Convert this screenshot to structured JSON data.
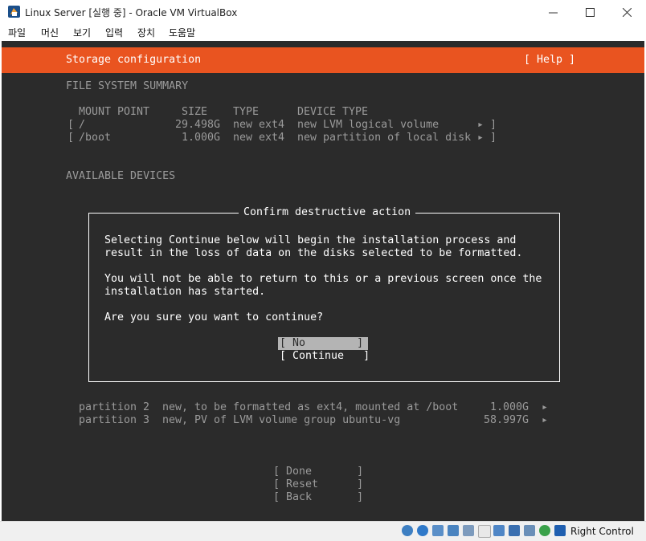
{
  "window": {
    "title": "Linux Server [실행 중] - Oracle VM VirtualBox",
    "minimize_icon": "minimize-icon",
    "maximize_icon": "maximize-icon",
    "close_icon": "close-icon"
  },
  "menu": [
    "파일",
    "머신",
    "보기",
    "입력",
    "장치",
    "도움말"
  ],
  "installer": {
    "header_title": "Storage configuration",
    "help_label": "[ Help ]",
    "fs_summary_heading": "FILE SYSTEM SUMMARY",
    "columns": [
      "MOUNT POINT",
      "SIZE",
      "TYPE",
      "DEVICE TYPE"
    ],
    "fs_rows": [
      {
        "mount": "/",
        "size": "29.498G",
        "type": "new ext4",
        "device": "new LVM logical volume"
      },
      {
        "mount": "/boot",
        "size": "1.000G",
        "type": "new ext4",
        "device": "new partition of local disk"
      }
    ],
    "available_devices_heading": "AVAILABLE DEVICES",
    "partitions": [
      {
        "name": "partition 2",
        "desc": "new, to be formatted as ext4, mounted at /boot",
        "size": "1.000G"
      },
      {
        "name": "partition 3",
        "desc": "new, PV of LVM volume group ubuntu-vg",
        "size": "58.997G"
      }
    ],
    "bottom_buttons": [
      "[ Done       ]",
      "[ Reset      ]",
      "[ Back       ]"
    ]
  },
  "dialog": {
    "title": "Confirm destructive action",
    "line1": "Selecting Continue below will begin the installation process and",
    "line2": "result in the loss of data on the disks selected to be formatted.",
    "line3": "You will not be able to return to this or a previous screen once the",
    "line4": "installation has started.",
    "question": "Are you sure you want to continue?",
    "no_label": "[ No        ]",
    "continue_label": "[ Continue   ]"
  },
  "status": {
    "host_key": "Right Control",
    "icons": [
      "hard-disk-icon",
      "optical-drive-icon",
      "audio-icon",
      "network-icon",
      "usb-icon",
      "shared-folders-icon",
      "display-icon",
      "video-capture-icon",
      "cpu-icon",
      "mouse-integration-icon",
      "keyboard-capture-icon"
    ],
    "colors": {
      "accent": "#e95420",
      "background": "#2b2b2b"
    }
  }
}
